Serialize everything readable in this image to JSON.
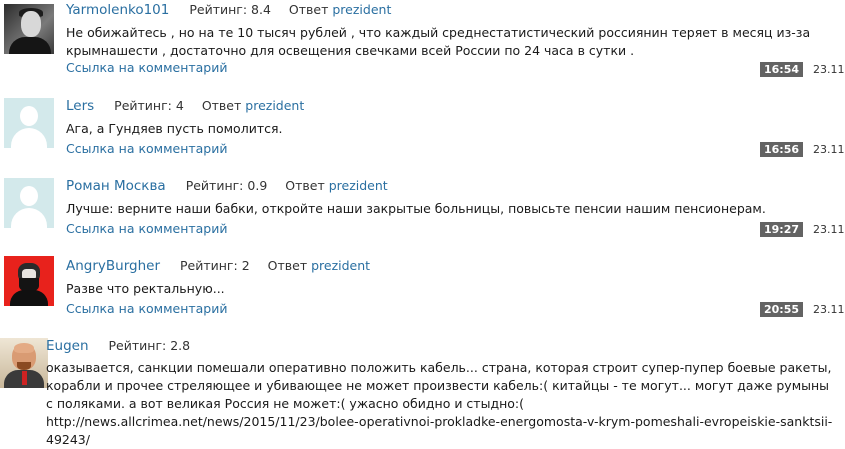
{
  "comments": [
    {
      "author": "Yarmolenko101",
      "rating_label": "Рейтинг:",
      "rating": "8.4",
      "reply_label": "Ответ",
      "reply_to": "prezident",
      "text": "Не обижайтесь , но на те 10 тысяч рублей , что каждый среднестатистический россиянин теряет в месяц из-за крымнашести , достаточно для освещения свечками всей России по 24 часа в сутки .",
      "link": "Ссылка на комментарий",
      "time": "16:54",
      "date": "23.11"
    },
    {
      "author": "Lers",
      "rating_label": "Рейтинг:",
      "rating": "4",
      "reply_label": "Ответ",
      "reply_to": "prezident",
      "text": "Ага, а Гундяев пусть помолится.",
      "link": "Ссылка на комментарий",
      "time": "16:56",
      "date": "23.11"
    },
    {
      "author": "Роман Москва",
      "rating_label": "Рейтинг:",
      "rating": "0.9",
      "reply_label": "Ответ",
      "reply_to": "prezident",
      "text": "Лучше: верните наши бабки, откройте наши закрытые больницы, повысьте пенсии нашим пенсионерам.",
      "link": "Ссылка на комментарий",
      "time": "19:27",
      "date": "23.11"
    },
    {
      "author": "AngryBurgher",
      "rating_label": "Рейтинг:",
      "rating": "2",
      "reply_label": "Ответ",
      "reply_to": "prezident",
      "text": "Разве что ректальную...",
      "link": "Ссылка на комментарий",
      "time": "20:55",
      "date": "23.11"
    },
    {
      "author": "Eugen",
      "rating_label": "Рейтинг:",
      "rating": "2.8",
      "text": "оказывается, санкции помешали оперативно положить кабель... страна, которая строит супер-пупер боевые ракеты, корабли и прочее стреляющее и убивающее не может произвести кабель:( китайцы - те могут... могут даже румыны с поляками. а вот великая Россия не может:( ужасно обидно и стыдно:( http://news.allcrimea.net/news/2015/11/23/bolee-operativnoi-prokladke-energomosta-v-krym-pomeshali-evropeiskie-sanktsii-49243/"
    }
  ]
}
